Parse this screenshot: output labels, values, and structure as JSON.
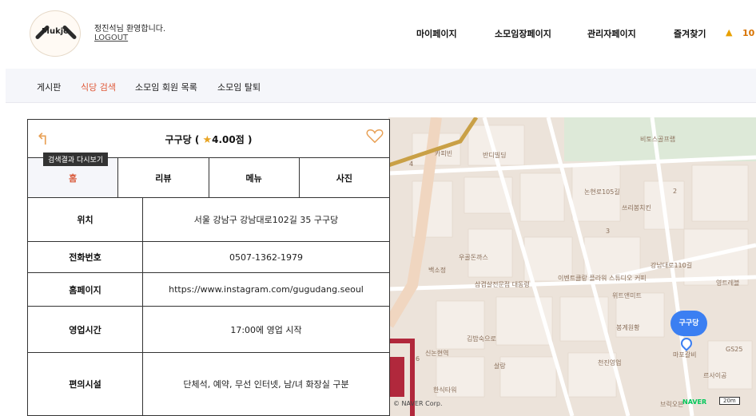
{
  "header": {
    "logo_text": "Mukjo",
    "welcome": "정진석님 환영합니다.",
    "logout": "LOGOUT",
    "nav": [
      "마이페이지",
      "소모임장페이지",
      "관리자페이지",
      "즐겨찾기"
    ],
    "bell_icon": "bell-icon",
    "notification_count": "10"
  },
  "subnav": {
    "items": [
      "게시판",
      "식당 검색",
      "소모임 회원 목록",
      "소모임 탈퇴"
    ],
    "active_index": 1
  },
  "panel": {
    "back_tooltip": "검색결과 다시보기",
    "title_name": "구구당",
    "title_open": " ( ",
    "title_star": "★",
    "title_rating": "4.00점",
    "title_close": " )",
    "tabs": [
      "홈",
      "리뷰",
      "메뉴",
      "사진"
    ],
    "active_tab": 0,
    "rows": [
      {
        "label": "위치",
        "value": "서울 강남구 강남대로102길 35 구구당"
      },
      {
        "label": "전화번호",
        "value": "0507-1362-1979"
      },
      {
        "label": "홈페이지",
        "value": "https://www.instagram.com/gugudang.seoul"
      },
      {
        "label": "영업시간",
        "value": "17:00에 영업 시작"
      },
      {
        "label": "편의시설",
        "value": "단체석, 예약, 무선 인터넷, 남/녀 화장실 구분"
      }
    ]
  },
  "map": {
    "labels": [
      "비토스골프랩",
      "카피빈",
      "반디빌딩",
      "논현로105길",
      "쓰리봉치킨",
      "우골돈까스",
      "백소정",
      "삼겹살전문점 대동령",
      "이벤트클랑 플라워 스튜디오 커피",
      "강남대로110길",
      "위트앤미트",
      "영트레블",
      "봉계원황",
      "김밥숙으로",
      "살랑",
      "신논현역",
      "천진영업",
      "한식타워",
      "GS25",
      "마포갈비",
      "르사이공",
      "브릭오븐",
      "4",
      "2",
      "3",
      "6"
    ],
    "pin_label": "구구당",
    "naver": "NAVER",
    "scale": "20m",
    "copyright": "© NAVER Corp."
  },
  "colors": {
    "accent": "#e05a3a",
    "pin": "#3b7ff2",
    "star": "#e8a422"
  }
}
